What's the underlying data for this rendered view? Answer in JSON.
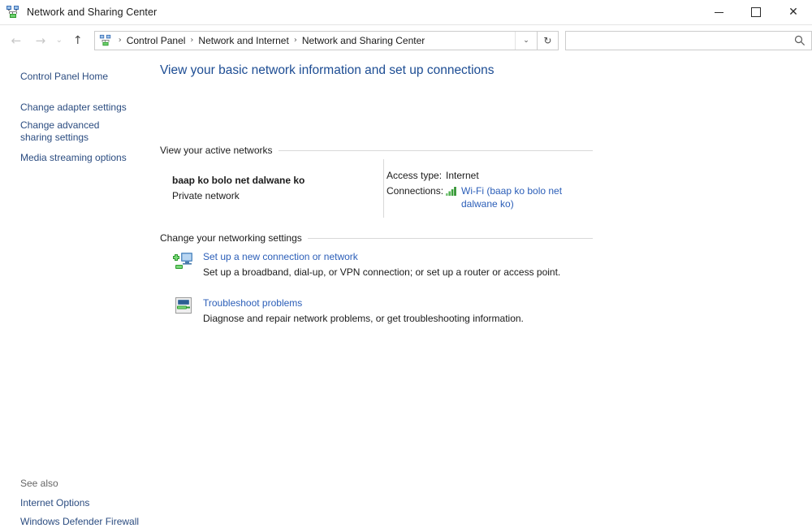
{
  "window": {
    "title": "Network and Sharing Center",
    "icon": "network-sharing-icon",
    "minimize_label": "—",
    "maximize_label": "",
    "close_label": "✕"
  },
  "navbar": {
    "back_label": "←",
    "forward_label": "→",
    "recent_label": "⌄",
    "up_label": "↑",
    "breadcrumbs": [
      "Control Panel",
      "Network and Internet",
      "Network and Sharing Center"
    ],
    "separator": "›",
    "dropdown_label": "⌄",
    "refresh_label": "↻",
    "search": {
      "value": "",
      "placeholder": ""
    }
  },
  "sidebar": {
    "items": [
      {
        "label": "Control Panel Home"
      },
      {
        "label": "Change adapter settings"
      },
      {
        "label": "Change advanced sharing settings"
      },
      {
        "label": "Media streaming options"
      }
    ],
    "see_also_title": "See also",
    "see_also": [
      {
        "label": "Internet Options"
      },
      {
        "label": "Windows Defender Firewall"
      }
    ]
  },
  "main": {
    "page_title": "View your basic network information and set up connections",
    "sections": [
      {
        "heading": "View your active networks"
      },
      {
        "heading": "Change your networking settings"
      }
    ],
    "active_network": {
      "name": "baap ko bolo net dalwane ko",
      "type": "Private network",
      "access_type_label": "Access type:",
      "access_type_value": "Internet",
      "connections_label": "Connections:",
      "connection_link": "Wi-Fi (baap ko bolo net dalwane ko)",
      "connection_icon": "wifi-signal-icon"
    },
    "tasks": [
      {
        "icon": "new-connection-icon",
        "title": "Set up a new connection or network",
        "description": "Set up a broadband, dial-up, or VPN connection; or set up a router or access point."
      },
      {
        "icon": "troubleshoot-icon",
        "title": "Troubleshoot problems",
        "description": "Diagnose and repair network problems, or get troubleshooting information."
      }
    ]
  },
  "colors": {
    "heading_blue": "#1c4c93",
    "link_blue": "#2b5eb8",
    "sidebar_link": "#2b4c80",
    "signal_green": "#3aa33a"
  }
}
